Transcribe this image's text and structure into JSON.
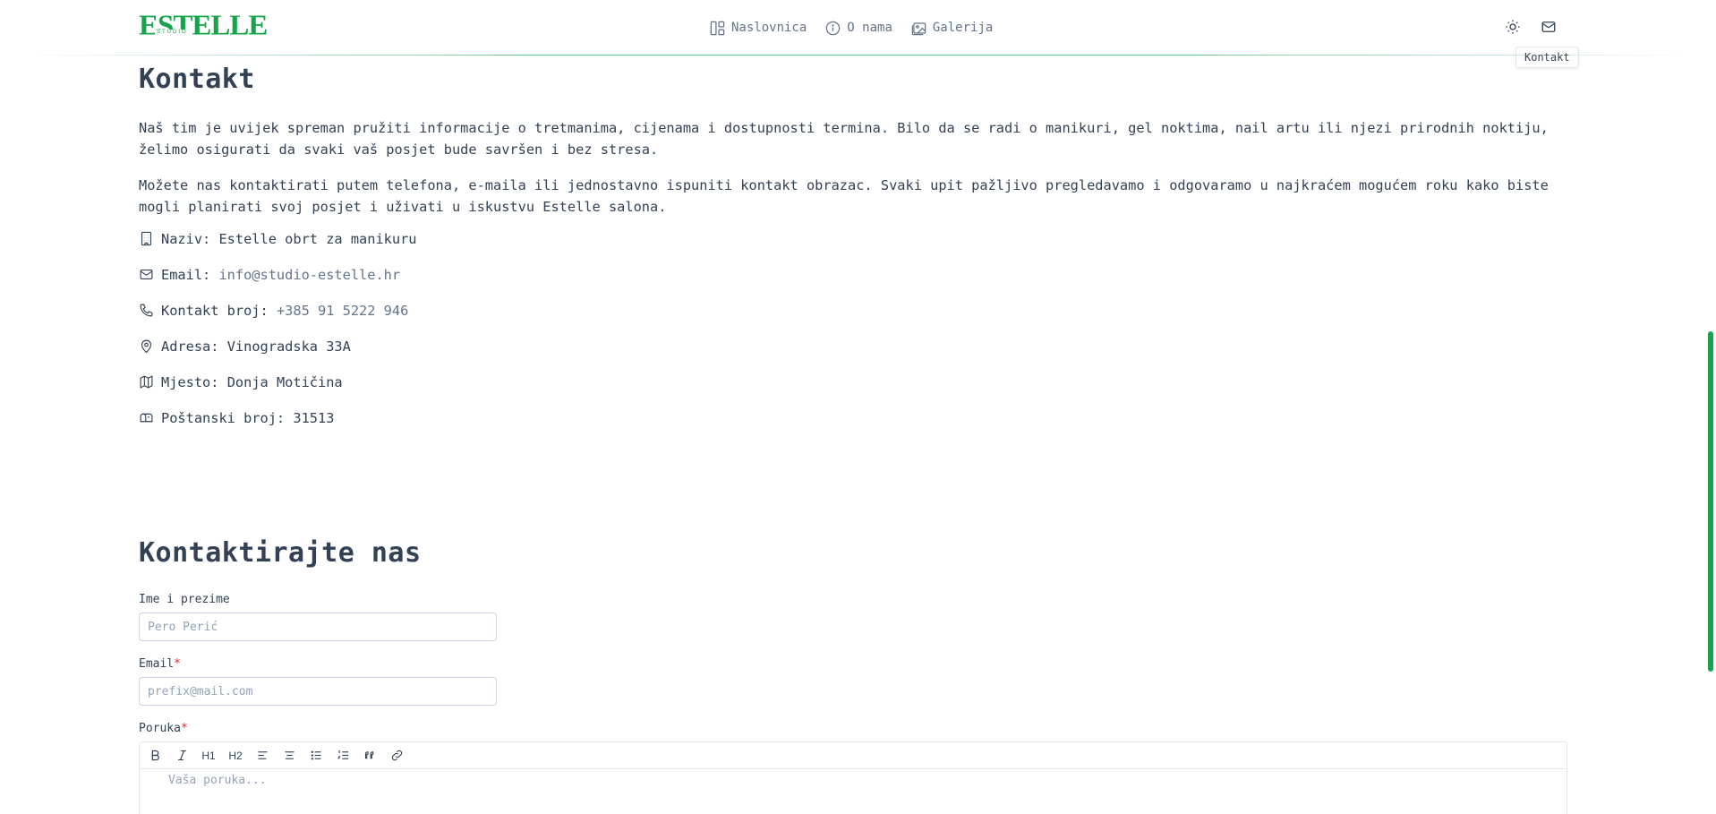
{
  "brand": {
    "logo_text": "ESTELLE",
    "logo_sub": "STUDIO",
    "accent_color": "#16a34a"
  },
  "nav": {
    "items": [
      {
        "label": "Naslovnica",
        "icon": "layout-icon"
      },
      {
        "label": "O nama",
        "icon": "info-icon"
      },
      {
        "label": "Galerija",
        "icon": "gallery-icon"
      }
    ]
  },
  "top_actions": {
    "theme_icon": "sun-icon",
    "contact_icon": "mail-icon",
    "tooltip": "Kontakt"
  },
  "contact": {
    "title": "Kontakt",
    "paragraphs": [
      "Naš tim je uvijek spreman pružiti informacije o tretmanima, cijenama i dostupnosti termina. Bilo da se radi o manikuri, gel noktima, nail artu ili njezi prirodnih noktiju, želimo osigurati da svaki vaš posjet bude savršen i bez stresa.",
      "Možete nas kontaktirati putem telefona, e-maila ili jednostavno ispuniti kontakt obrazac. Svaki upit pažljivo pregledavamo i odgovaramo u najkraćem mogućem roku kako biste mogli planirati svoj posjet i uživati u iskustvu Estelle salona."
    ],
    "info": [
      {
        "label": "Naziv: ",
        "value": "Estelle obrt za manikuru",
        "icon": "building-icon"
      },
      {
        "label": "Email: ",
        "value": "info@studio-estelle.hr",
        "icon": "mail-icon"
      },
      {
        "label": "Kontakt broj: ",
        "value": "+385 91 5222 946",
        "icon": "phone-icon"
      },
      {
        "label": "Adresa: ",
        "value": "Vinogradska 33A",
        "icon": "map-pin-icon"
      },
      {
        "label": "Mjesto: ",
        "value": "Donja Motičina",
        "icon": "map-icon"
      },
      {
        "label": "Poštanski broj: ",
        "value": "31513",
        "icon": "mailbox-icon"
      }
    ]
  },
  "form": {
    "title": "Kontaktirajte nas",
    "name_label": "Ime i prezime",
    "name_placeholder": "Pero Perić",
    "email_label": "Email",
    "email_placeholder": "prefix@mail.com",
    "message_label": "Poruka",
    "required_mark": "*",
    "message_placeholder": "Vaša poruka...",
    "toolbar": {
      "bold": "bold-icon",
      "italic": "italic-icon",
      "h1": "H1",
      "h2": "H2",
      "align_left": "align-left-icon",
      "align_center": "align-center-icon",
      "bullet_list": "bullet-list-icon",
      "ordered_list": "ordered-list-icon",
      "quote": "quote-icon",
      "link": "link-icon"
    }
  }
}
